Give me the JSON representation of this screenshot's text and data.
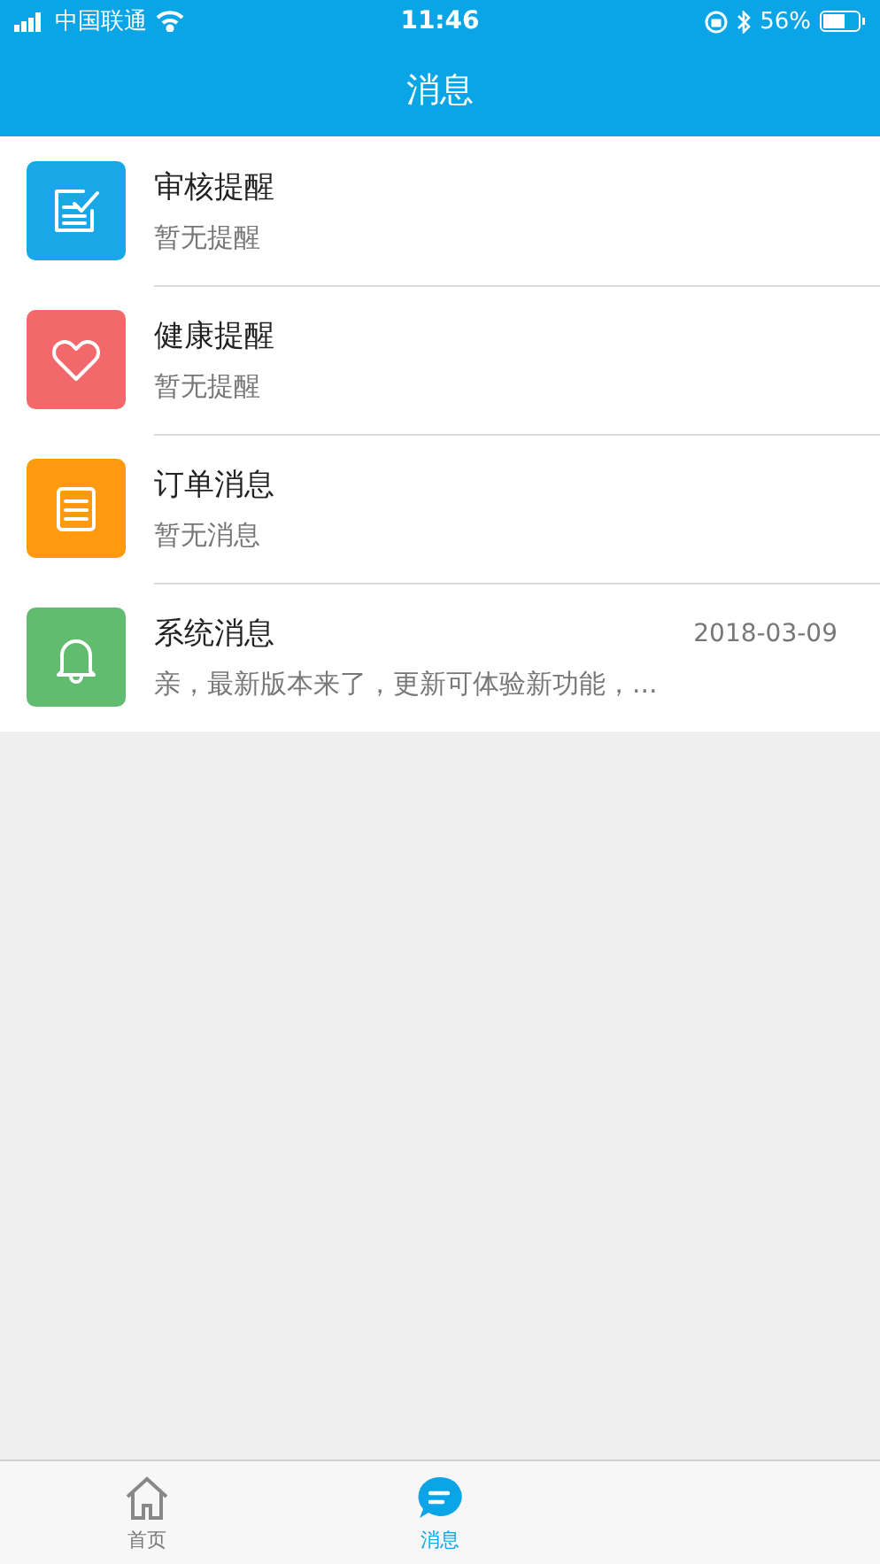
{
  "status_bar": {
    "carrier": "中国联通",
    "time": "11:46",
    "battery": "56%"
  },
  "nav": {
    "title": "消息"
  },
  "messages": [
    {
      "kind": "review",
      "color": "#1aa7e8",
      "title": "审核提醒",
      "preview": "暂无提醒"
    },
    {
      "kind": "health",
      "color": "#f3686b",
      "title": "健康提醒",
      "preview": "暂无提醒"
    },
    {
      "kind": "order",
      "color": "#fd9a10",
      "title": "订单消息",
      "preview": "暂无消息"
    },
    {
      "kind": "system",
      "color": "#62bc70",
      "title": "系统消息",
      "preview": "亲，最新版本来了，更新可体验新功能，...",
      "date": "2018-03-09"
    }
  ],
  "tabs": [
    {
      "kind": "home",
      "label": "首页",
      "selected": false
    },
    {
      "kind": "messages",
      "label": "消息",
      "selected": true
    }
  ]
}
